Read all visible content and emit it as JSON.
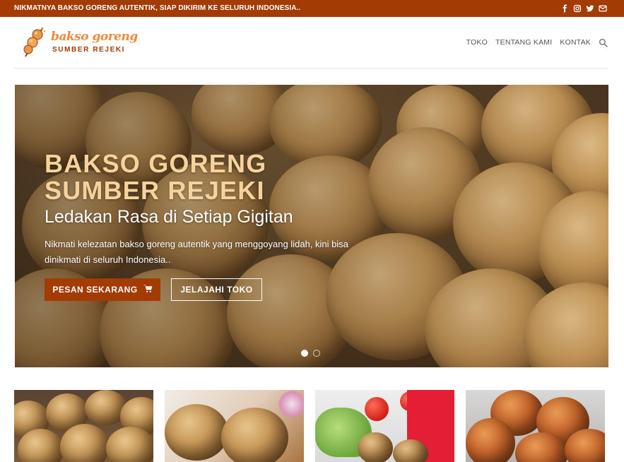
{
  "topbar": {
    "announcement": "NIKMATNYA BAKSO GORENG AUTENTIK, SIAP DIKIRIM KE SELURUH INDONESIA..",
    "social_icons": [
      "facebook-icon",
      "instagram-icon",
      "twitter-icon",
      "email-icon"
    ]
  },
  "header": {
    "logo": {
      "main": "bakso goreng",
      "sub": "SUMBER REJEKI"
    },
    "nav": [
      {
        "label": "TOKO"
      },
      {
        "label": "TENTANG KAMI"
      },
      {
        "label": "KONTAK"
      }
    ],
    "search_icon": "search-icon"
  },
  "hero": {
    "title_line1": "BAKSO GORENG",
    "title_line2": "SUMBER REJEKI",
    "subtitle": "Ledakan Rasa di Setiap Gigitan",
    "description": "Nikmati kelezatan bakso goreng autentik yang menggoyang lidah, kini bisa dinikmati di seluruh Indonesia..",
    "primary_button": "PESAN SEKARANG",
    "primary_button_icon": "cart-icon",
    "secondary_button": "JELAJAHI TOKO",
    "slides_total": 2,
    "active_slide": 1
  },
  "colors": {
    "brand": "#a33b05",
    "logo_orange": "#f08a3a",
    "hero_title": "#f6d39a"
  }
}
